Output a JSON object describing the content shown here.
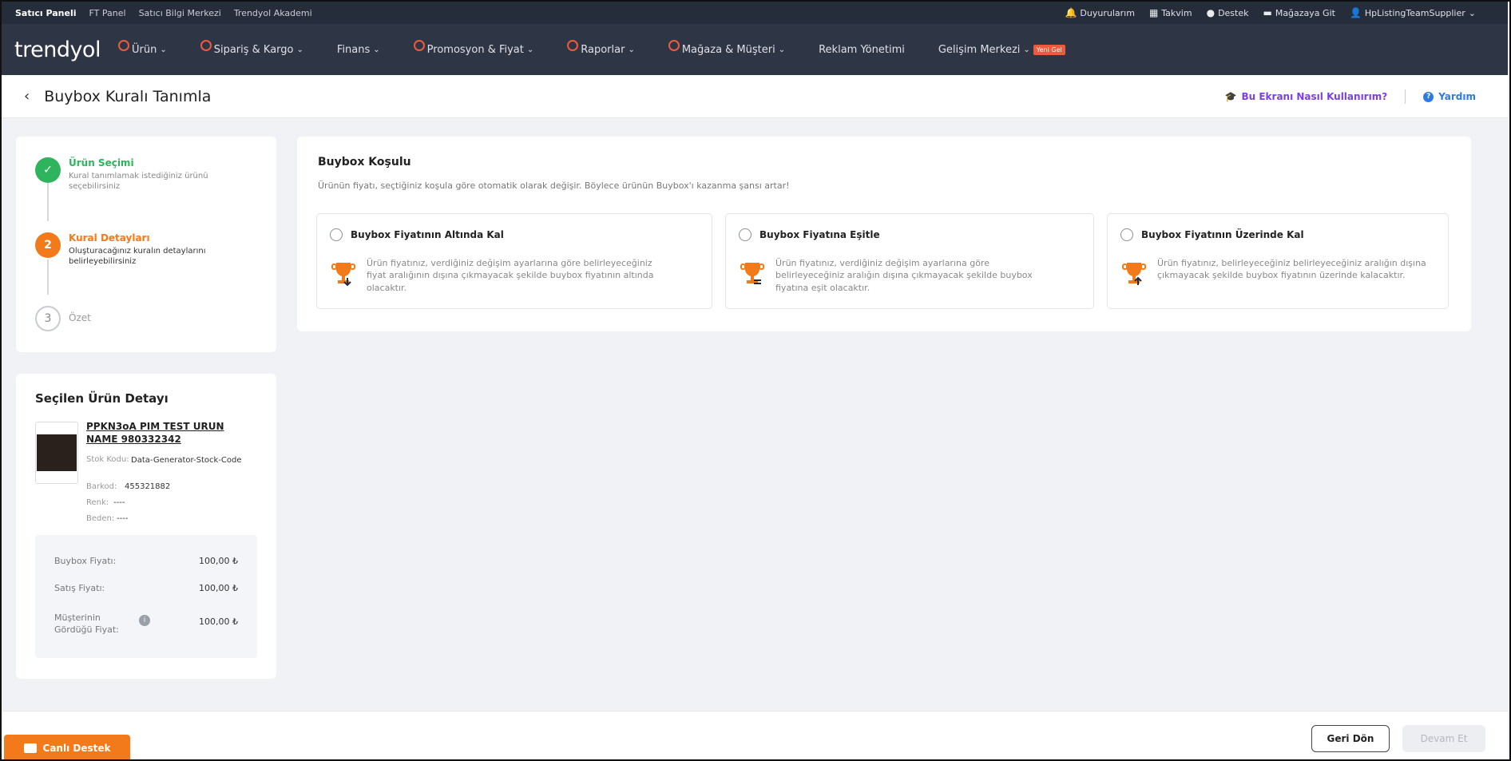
{
  "topbar": {
    "links": [
      "Satıcı Paneli",
      "FT Panel",
      "Satıcı Bilgi Merkezi",
      "Trendyol Akademi"
    ],
    "right": [
      {
        "icon": "bell-icon",
        "label": "Duyurularım"
      },
      {
        "icon": "calendar-icon",
        "label": "Takvim"
      },
      {
        "icon": "chat-icon",
        "label": "Destek"
      },
      {
        "icon": "store-icon",
        "label": "Mağazaya Git"
      },
      {
        "icon": "user-icon",
        "label": "HpListingTeamSupplier"
      }
    ]
  },
  "nav": {
    "logo": "trendyol",
    "items": [
      "Ürün",
      "Sipariş & Kargo",
      "Finans",
      "Promosyon & Fiyat",
      "Raporlar",
      "Mağaza & Müşteri",
      "Reklam Yönetimi",
      "Gelişim Merkezi"
    ],
    "new_badge": "Yeni Gel"
  },
  "header": {
    "title": "Buybox Kuralı Tanımla",
    "howto": "Bu Ekranı Nasıl Kullanırım?",
    "help": "Yardım"
  },
  "steps": [
    {
      "num": "✓",
      "title": "Ürün Seçimi",
      "desc": "Kural tanımlamak istediğiniz ürünü seçebilirsiniz"
    },
    {
      "num": "2",
      "title": "Kural Detayları",
      "desc": "Oluşturacağınız kuralın detaylarını belirleyebilirsiniz"
    },
    {
      "num": "3",
      "title": "Özet",
      "desc": ""
    }
  ],
  "product": {
    "heading": "Seçilen Ürün Detayı",
    "name": "PPKN3oA PIM TEST URUN NAME 980332342",
    "stock_label": "Stok Kodu:",
    "stock_value": "Data-Generator-Stock-Code",
    "barcode_label": "Barkod:",
    "barcode_value": "455321882",
    "color_label": "Renk:",
    "color_value": "----",
    "size_label": "Beden:",
    "size_value": "----",
    "prices": [
      {
        "label": "Buybox Fiyatı:",
        "value": "100,00 ₺"
      },
      {
        "label": "Satış Fiyatı:",
        "value": "100,00 ₺"
      },
      {
        "label": "Müşterinin Gördüğü Fiyat:",
        "value": "100,00 ₺"
      }
    ]
  },
  "condition": {
    "title": "Buybox Koşulu",
    "subtitle": "Ürünün fiyatı, seçtiğiniz koşula göre otomatik olarak değişir. Böylece ürünün Buybox'ı kazanma şansı artar!",
    "options": [
      {
        "title": "Buybox Fiyatının Altında Kal",
        "desc": "Ürün fiyatınız, verdiğiniz değişim ayarlarına göre belirleyeceğiniz fiyat aralığının dışına çıkmayacak şekilde buybox fiyatının altında olacaktır."
      },
      {
        "title": "Buybox Fiyatına Eşitle",
        "desc": "Ürün fiyatınız, verdiğiniz değişim ayarlarına göre belirleyeceğiniz aralığın dışına çıkmayacak şekilde buybox fiyatına eşit olacaktır."
      },
      {
        "title": "Buybox Fiyatının Üzerinde Kal",
        "desc": "Ürün fiyatınız, belirleyeceğiniz belirleyeceğiniz aralığın dışına çıkmayacak şekilde buybox fiyatının üzerinde kalacaktır."
      }
    ]
  },
  "footer": {
    "back": "Geri Dön",
    "next": "Devam Et",
    "live": "Canlı Destek"
  },
  "colors": {
    "accent": "#f27a1a",
    "nav_bg": "#2e3545",
    "success": "#2db45d",
    "promo": "#7b3fe4"
  }
}
